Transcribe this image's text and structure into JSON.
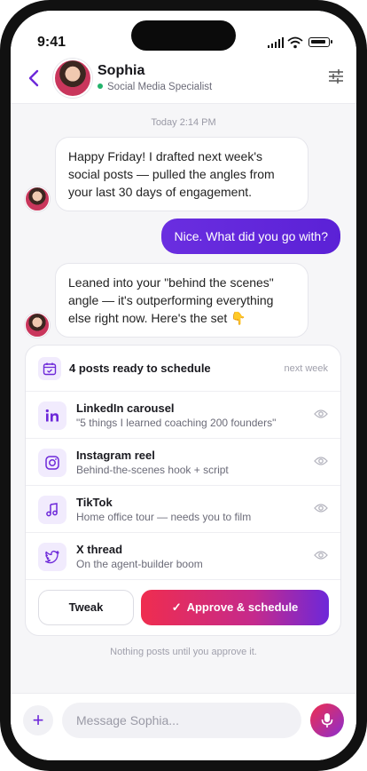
{
  "status_bar": {
    "time": "9:41"
  },
  "header": {
    "name": "Sophia",
    "role": "Social Media Specialist"
  },
  "chat": {
    "day_label": "Today 2:14 PM",
    "messages": [
      {
        "from": "agent",
        "text": "Happy Friday! I drafted next week's social posts — pulled the angles from your last 30 days of engagement."
      },
      {
        "from": "user",
        "text": "Nice. What did you go with?"
      },
      {
        "from": "agent",
        "text": "Leaned into your \"behind the scenes\" angle — it's outperforming everything else right now. Here's the set 👇"
      }
    ]
  },
  "schedule_card": {
    "title": "4 posts ready to schedule",
    "meta": "next week",
    "posts": [
      {
        "icon": "linkedin-icon",
        "title": "LinkedIn carousel",
        "subtitle": "\"5 things I learned coaching 200 founders\""
      },
      {
        "icon": "instagram-icon",
        "title": "Instagram reel",
        "subtitle": "Behind-the-scenes hook + script"
      },
      {
        "icon": "tiktok-icon",
        "title": "TikTok",
        "subtitle": "Home office tour — needs you to film"
      },
      {
        "icon": "twitter-icon",
        "title": "X thread",
        "subtitle": "On the agent-builder boom"
      }
    ],
    "tweak_label": "Tweak",
    "approve_label": "Approve & schedule"
  },
  "approval_note": "Nothing posts until you approve it.",
  "composer": {
    "placeholder": "Message Sophia..."
  },
  "colors": {
    "accent": "#6d28d9",
    "approve_start": "#ef2d4f",
    "online": "#22b36b"
  }
}
